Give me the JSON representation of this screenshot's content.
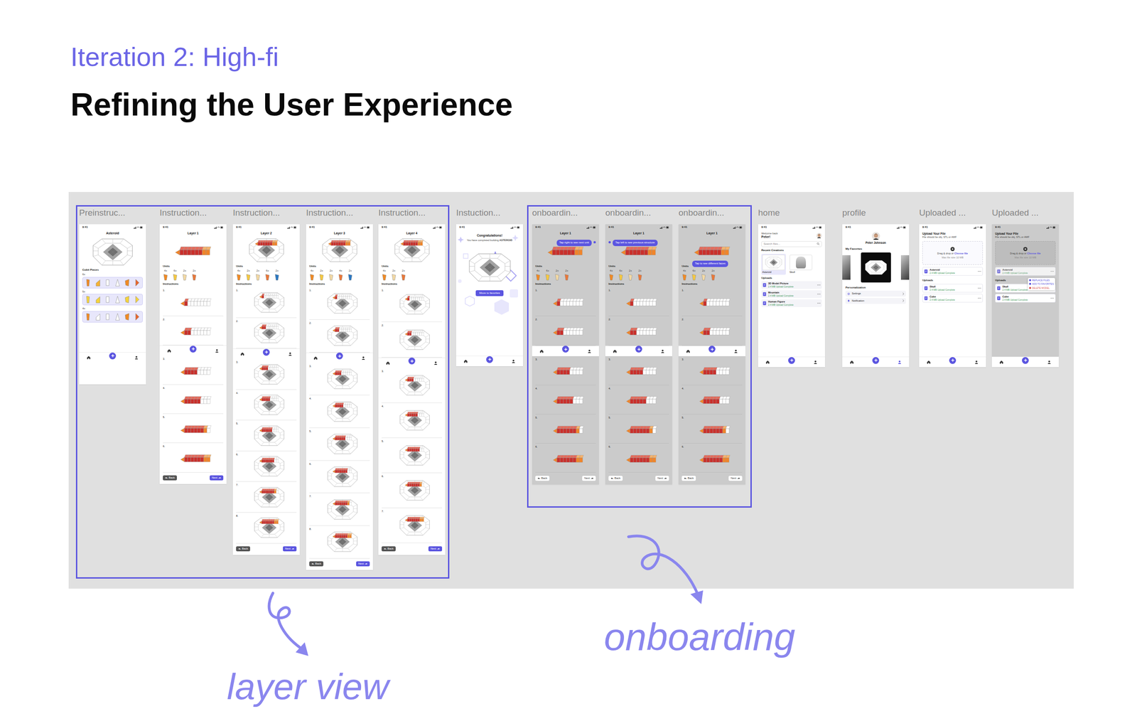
{
  "header": {
    "kicker": "Iteration 2: High-fi",
    "title": "Refining the User Experience"
  },
  "groups": [
    {
      "label": "layer view"
    },
    {
      "label": "onboarding"
    }
  ],
  "frames": [
    {
      "label": "Preinstruc...",
      "kind": "preinstruction",
      "time": "9:41",
      "title": "Asteroid",
      "profileTabSelected": false,
      "hero": {
        "kind": "model",
        "level": 0
      },
      "section": "Cubit Pieces",
      "groups": [
        {
          "count": "6x",
          "pieces": [
            "#f08a24",
            "#f5b335",
            "#ffffff",
            "#ffffff",
            "#f08a24",
            "#e8652a"
          ]
        },
        {
          "count": "5x",
          "pieces": [
            "#f5d33b",
            "#f5d33b",
            "#ffffff",
            "#ffffff",
            "#f5d33b",
            "#f5d33b"
          ]
        },
        {
          "count": "4x",
          "pieces": [
            "#f08a24",
            "#ffffff",
            "#ffffff",
            "#ffffff",
            "#f08a24",
            "#e8652a"
          ]
        }
      ]
    },
    {
      "label": "Instruction...",
      "kind": "instruction",
      "time": "9:41",
      "title": "Layer 1",
      "profileTabSelected": false,
      "hero": {
        "kind": "strip",
        "level": 1
      },
      "unitsLabel": "Units",
      "units": [
        {
          "count": "4x",
          "color": "#f08a24"
        },
        {
          "count": "6x",
          "color": "#f5c842"
        },
        {
          "count": "2x",
          "color": "#f3d9a4"
        },
        {
          "count": "2x",
          "color": "#e9783a"
        }
      ],
      "instructionsLabel": "Instructions",
      "steps": [
        {
          "n": "1.",
          "kind": "strip",
          "level": 0.13
        },
        {
          "n": "2.",
          "kind": "strip",
          "level": 0.25
        },
        {
          "n": "3.",
          "kind": "strip",
          "level": 0.5
        },
        {
          "n": "4.",
          "kind": "strip",
          "level": 0.63
        },
        {
          "n": "5.",
          "kind": "strip",
          "level": 0.88
        },
        {
          "n": "6.",
          "kind": "strip",
          "level": 1
        }
      ],
      "back": "Back",
      "next": "Next"
    },
    {
      "label": "Instruction...",
      "kind": "instruction",
      "time": "9:41",
      "title": "Layer 2",
      "profileTabSelected": false,
      "hero": {
        "kind": "model",
        "level": 1
      },
      "unitsLabel": "Units",
      "units": [
        {
          "count": "4x",
          "color": "#f08a24"
        },
        {
          "count": "2x",
          "color": "#f5c842"
        },
        {
          "count": "2x",
          "color": "#f3d9a4"
        },
        {
          "count": "6x",
          "color": "#e9783a"
        },
        {
          "count": "2x",
          "color": "#2b78c2"
        }
      ],
      "instructionsLabel": "Instructions",
      "steps": [
        {
          "n": "1.",
          "kind": "model",
          "level": 0.13
        },
        {
          "n": "2.",
          "kind": "model",
          "level": 0.25
        },
        {
          "n": "3.",
          "kind": "model",
          "level": 0.38
        },
        {
          "n": "4.",
          "kind": "model",
          "level": 0.5
        },
        {
          "n": "5.",
          "kind": "model",
          "level": 0.63
        },
        {
          "n": "6.",
          "kind": "model",
          "level": 0.75
        },
        {
          "n": "7.",
          "kind": "model",
          "level": 0.88
        },
        {
          "n": "8.",
          "kind": "model",
          "level": 1
        }
      ],
      "back": "Back",
      "next": "Next"
    },
    {
      "label": "Instruction...",
      "kind": "instruction",
      "time": "9:41",
      "title": "Layer 3",
      "profileTabSelected": false,
      "hero": {
        "kind": "model",
        "level": 1
      },
      "unitsLabel": "Units",
      "units": [
        {
          "count": "4x",
          "color": "#f08a24"
        },
        {
          "count": "2x",
          "color": "#f5c842"
        },
        {
          "count": "2x",
          "color": "#f3d9a4"
        },
        {
          "count": "4x",
          "color": "#e9783a"
        },
        {
          "count": "2x",
          "color": "#2b78c2"
        }
      ],
      "instructionsLabel": "Instructions",
      "steps": [
        {
          "n": "1.",
          "kind": "model",
          "level": 0.13
        },
        {
          "n": "2.",
          "kind": "model",
          "level": 0.25
        },
        {
          "n": "3.",
          "kind": "model",
          "level": 0.38
        },
        {
          "n": "4.",
          "kind": "model",
          "level": 0.5
        },
        {
          "n": "5.",
          "kind": "model",
          "level": 0.63
        },
        {
          "n": "6.",
          "kind": "model",
          "level": 0.75
        },
        {
          "n": "7.",
          "kind": "model",
          "level": 0.88
        },
        {
          "n": "8.",
          "kind": "model",
          "level": 1
        }
      ],
      "back": "Back",
      "next": "Next"
    },
    {
      "label": "Instruction...",
      "kind": "instruction",
      "time": "9:41",
      "title": "Layer 4",
      "profileTabSelected": false,
      "hero": {
        "kind": "model",
        "level": 1
      },
      "unitsLabel": "Units",
      "units": [
        {
          "count": "4x",
          "color": "#f08a24"
        },
        {
          "count": "2x",
          "color": "#f3d9a4"
        },
        {
          "count": "2x",
          "color": "#e9783a"
        }
      ],
      "instructionsLabel": "Instructions",
      "steps": [
        {
          "n": "1.",
          "kind": "model",
          "level": 0.14
        },
        {
          "n": "2.",
          "kind": "model",
          "level": 0.29
        },
        {
          "n": "3.",
          "kind": "model",
          "level": 0.43
        },
        {
          "n": "4.",
          "kind": "model",
          "level": 0.57
        },
        {
          "n": "5.",
          "kind": "model",
          "level": 0.71
        },
        {
          "n": "6.",
          "kind": "model",
          "level": 0.86
        },
        {
          "n": "7.",
          "kind": "model",
          "level": 1
        }
      ],
      "back": "Back",
      "next": "Next"
    },
    {
      "label": "Instuction...",
      "kind": "complete",
      "time": "9:41",
      "profileTabSelected": false,
      "title": "Congratulations!",
      "message": "You have completed building",
      "model": "ASTEROID",
      "button": "Move to favorites"
    },
    {
      "label": "onboardin...",
      "kind": "onboarding",
      "time": "9:41",
      "title": "Layer 1",
      "profileTabSelected": false,
      "tip": "Tap right to see next unit",
      "hero": {
        "kind": "strip",
        "level": 1
      },
      "unitsLabel": "Units",
      "units": [
        {
          "count": "4x",
          "color": "#f08a24"
        },
        {
          "count": "6x",
          "color": "#f5c842"
        },
        {
          "count": "2x",
          "color": "#f3d9a4"
        },
        {
          "count": "2x",
          "color": "#e9783a"
        }
      ],
      "instructionsLabel": "Instructions",
      "steps": [
        {
          "n": "1.",
          "kind": "strip",
          "level": 0.13
        },
        {
          "n": "2.",
          "kind": "strip",
          "level": 0.25
        },
        {
          "n": "3.",
          "kind": "strip",
          "level": 0.5
        },
        {
          "n": "4.",
          "kind": "strip",
          "level": 0.63
        },
        {
          "n": "5.",
          "kind": "strip",
          "level": 0.88
        },
        {
          "n": "6.",
          "kind": "strip",
          "level": 1
        }
      ],
      "back": "Back",
      "next": "Next"
    },
    {
      "label": "onboardin...",
      "kind": "onboarding",
      "time": "9:41",
      "title": "Layer 1",
      "profileTabSelected": false,
      "tip": "Tap left to see previous structure",
      "hero": {
        "kind": "strip",
        "level": 1
      },
      "unitsLabel": "Units",
      "units": [
        {
          "count": "4x",
          "color": "#f08a24"
        },
        {
          "count": "6x",
          "color": "#f5c842"
        },
        {
          "count": "2x",
          "color": "#f3d9a4"
        },
        {
          "count": "2x",
          "color": "#e9783a"
        }
      ],
      "instructionsLabel": "Instructions",
      "steps": [
        {
          "n": "1.",
          "kind": "strip",
          "level": 0.13
        },
        {
          "n": "2.",
          "kind": "strip",
          "level": 0.25
        },
        {
          "n": "3.",
          "kind": "strip",
          "level": 0.5
        },
        {
          "n": "4.",
          "kind": "strip",
          "level": 0.63
        },
        {
          "n": "5.",
          "kind": "strip",
          "level": 0.88
        },
        {
          "n": "6.",
          "kind": "strip",
          "level": 1
        }
      ],
      "back": "Back",
      "next": "Next"
    },
    {
      "label": "onboardin...",
      "kind": "onboarding",
      "time": "9:41",
      "title": "Layer 1",
      "profileTabSelected": false,
      "tip": "Tap to see different faces",
      "hero": {
        "kind": "strip",
        "level": 1
      },
      "unitsLabel": "Units",
      "units": [
        {
          "count": "4x",
          "color": "#f08a24"
        },
        {
          "count": "6x",
          "color": "#f5c842"
        },
        {
          "count": "2x",
          "color": "#f3d9a4"
        },
        {
          "count": "2x",
          "color": "#e9783a"
        }
      ],
      "instructionsLabel": "Instructions",
      "steps": [
        {
          "n": "1.",
          "kind": "strip",
          "level": 0.13
        },
        {
          "n": "2.",
          "kind": "strip",
          "level": 0.25
        },
        {
          "n": "3.",
          "kind": "strip",
          "level": 0.5
        },
        {
          "n": "4.",
          "kind": "strip",
          "level": 0.63
        },
        {
          "n": "5.",
          "kind": "strip",
          "level": 0.88
        },
        {
          "n": "6.",
          "kind": "strip",
          "level": 1
        }
      ],
      "back": "Back",
      "next": "Next"
    },
    {
      "label": "home",
      "kind": "home",
      "time": "9:41",
      "profileTabSelected": false,
      "greeting": "Welcome back",
      "name": "Peter!",
      "search": "Search files...",
      "recentLabel": "Recent Creations",
      "recent": [
        {
          "name": "Asteroid",
          "kind": "model",
          "selected": true
        },
        {
          "name": "Skull",
          "kind": "bust",
          "selected": false
        }
      ],
      "uploadsLabel": "Uploads",
      "uploads": [
        {
          "name": "3D Model Picture",
          "meta": "2.4 MB Upload Complete"
        },
        {
          "name": "Mountain",
          "meta": "2.4 MB Upload Complete"
        },
        {
          "name": "Human Figure",
          "meta": "2.4 MB Upload Complete"
        }
      ]
    },
    {
      "label": "profile",
      "kind": "profile",
      "time": "9:41",
      "profileTabSelected": true,
      "name": "Peter Johnson",
      "favoritesLabel": "My Favorites",
      "favorites": [
        {
          "kind": "photo"
        },
        {
          "kind": "model"
        },
        {
          "kind": "photo"
        }
      ],
      "personalLabel": "Personalization",
      "settings": [
        {
          "label": "Settings",
          "kind": "gear"
        },
        {
          "label": "Notification",
          "kind": "bell"
        }
      ]
    },
    {
      "label": "Uploaded ...",
      "kind": "upload",
      "time": "9:41",
      "profileTabSelected": false,
      "dimmed": false,
      "title": "Upload Your File",
      "hint": "File should be obj, STL or AMF",
      "drop": "Drag & drop or",
      "choose": "Choose file",
      "limit": "Max file size 10 MB",
      "current": {
        "name": "Asteroid",
        "meta": "2.4 MB Upload Complete"
      },
      "uploadsLabel": "Uploads",
      "uploads": [
        {
          "name": "Skull",
          "meta": "2.4 MB Upload Complete"
        },
        {
          "name": "Cube",
          "meta": "2.4 MB Upload Complete"
        }
      ],
      "menu": []
    },
    {
      "label": "Uploaded ...",
      "kind": "upload",
      "time": "9:41",
      "profileTabSelected": false,
      "dimmed": true,
      "title": "Upload Your File",
      "hint": "File should be obj, STL or AMF",
      "drop": "Drag & drop or",
      "choose": "Choose file",
      "limit": "Max file size 10 MB",
      "current": {
        "name": "Asteroid",
        "meta": "2.4 MB Upload Complete"
      },
      "uploadsLabel": "Uploads",
      "uploads": [
        {
          "name": "Skull",
          "meta": "2.4 MB Upload Complete"
        },
        {
          "name": "Cube",
          "meta": "2.4 MB Upload Complete"
        }
      ],
      "menu": [
        "REPLACE FILES",
        "ADD TO FAVORITES",
        "DELETE MODEL"
      ]
    }
  ]
}
